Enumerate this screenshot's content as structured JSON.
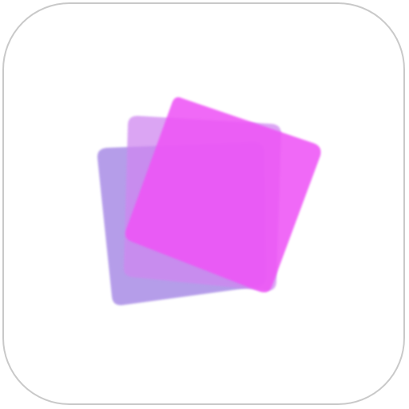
{
  "app_icon": {
    "icon": "layered-cards-icon",
    "colors": {
      "border": "#c9c9c9",
      "background": "#ffffff",
      "back_card": "#a98ce6",
      "middle_card": "#cf87f0",
      "front_card": "#ee55f6"
    }
  }
}
